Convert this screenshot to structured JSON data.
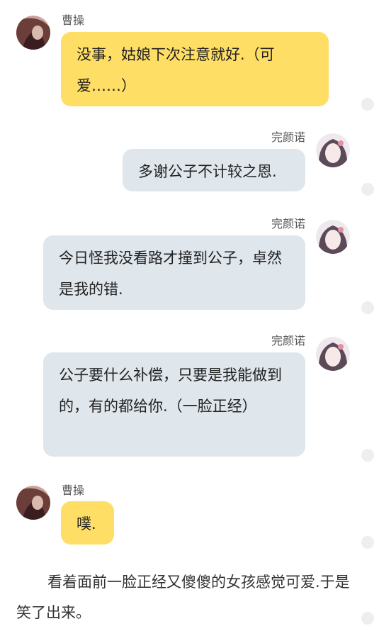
{
  "messages": [
    {
      "sender": "曹操",
      "side": "left",
      "text": "没事，姑娘下次注意就好.（可爱……）"
    },
    {
      "sender": "完颜诺",
      "side": "right",
      "text": "多谢公子不计较之恩."
    },
    {
      "sender": "完颜诺",
      "side": "right",
      "text": "今日怪我没看路才撞到公子，卓然是我的错."
    },
    {
      "sender": "完颜诺",
      "side": "right",
      "text": "公子要什么补偿，只要是我能做到的，有的都给你.（一脸正经）"
    },
    {
      "sender": "曹操",
      "side": "left",
      "text": "噗."
    }
  ],
  "narration": "看着面前一脸正经又傻傻的女孩感觉可爱.于是笑了出来。",
  "colors": {
    "left_bubble": "#ffde66",
    "right_bubble": "#dfe6ec",
    "background": "#ffffff"
  },
  "icons": {
    "left_avatar": "cao-cao-avatar",
    "right_avatar": "wanyan-nuo-avatar",
    "side_dot": "dot-icon"
  }
}
